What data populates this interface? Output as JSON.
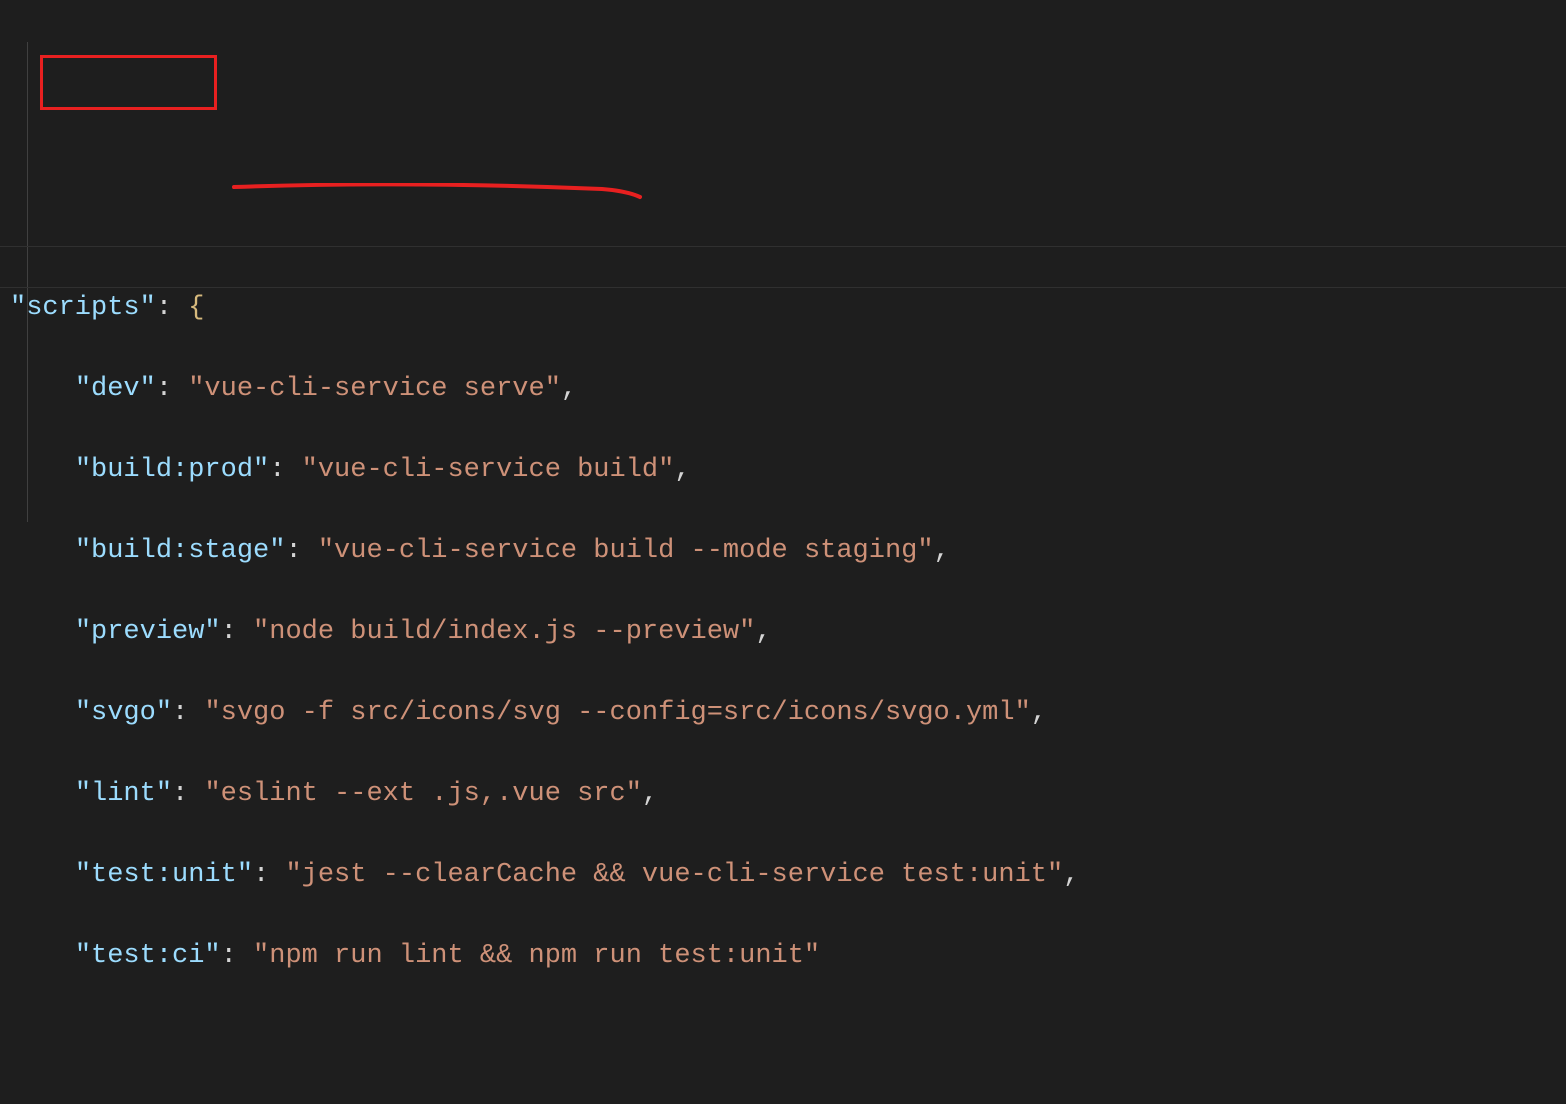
{
  "code": {
    "scripts_key": "\"scripts\"",
    "entries": [
      {
        "key": "\"dev\"",
        "value": "\"vue-cli-service serve\""
      },
      {
        "key": "\"build:prod\"",
        "value": "\"vue-cli-service build\""
      },
      {
        "key": "\"build:stage\"",
        "value": "\"vue-cli-service build --mode staging\""
      },
      {
        "key": "\"preview\"",
        "value": "\"node build/index.js --preview\""
      },
      {
        "key": "\"svgo\"",
        "value": "\"svgo -f src/icons/svg --config=src/icons/svgo.yml\""
      },
      {
        "key": "\"lint\"",
        "value": "\"eslint --ext .js,.vue src\""
      },
      {
        "key": "\"test:unit\"",
        "value": "\"jest --clearCache && vue-cli-service test:unit\""
      },
      {
        "key": "\"test:ci\"",
        "value": "\"npm run lint && npm run test:unit\""
      }
    ],
    "colon_space": ": ",
    "open_brace": "{",
    "comma": ","
  },
  "annotations": {
    "boxed_key": "dev",
    "underlined_value": "vue-cli-service serve"
  }
}
